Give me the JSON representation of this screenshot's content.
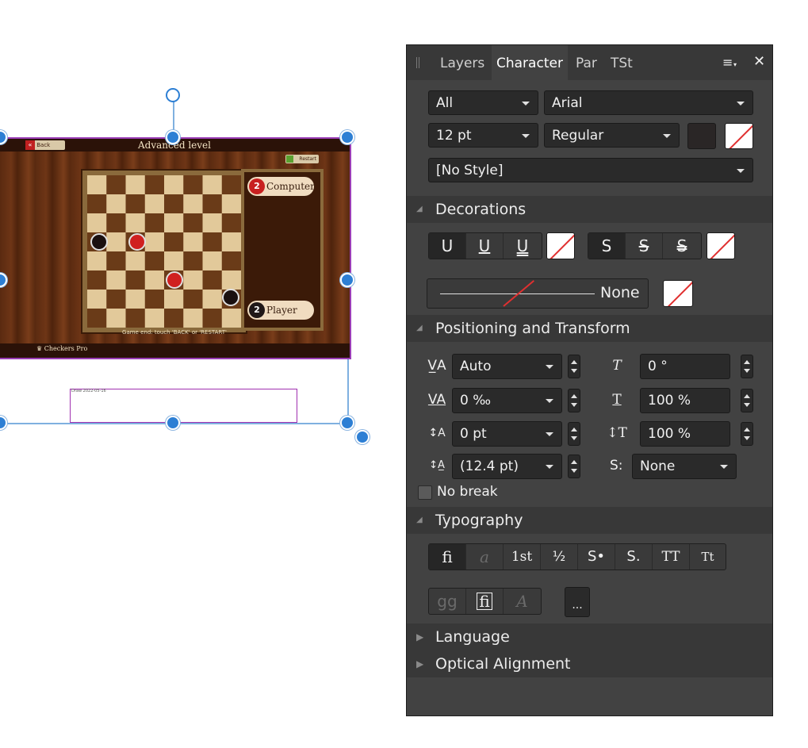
{
  "canvas": {
    "game": {
      "back_label": "Back",
      "title": "Advanced level",
      "restart_label": "Restart",
      "players": [
        {
          "num": "2",
          "name": "Computer"
        },
        {
          "num": "2",
          "name": "Player"
        }
      ],
      "footer_msg": "Game end: touch 'BACK' or 'RESTART'",
      "brand": "Checkers Pro"
    },
    "textframe_content": "Draw  2022-05-16"
  },
  "panel": {
    "tabs": [
      "Layers",
      "Character",
      "Par",
      "TSt"
    ],
    "active_tab": "Character",
    "font_collection": "All",
    "font_family": "Arial",
    "font_size": "12 pt",
    "font_style": "Regular",
    "text_style": "[No Style]",
    "sections": {
      "decorations": "Decorations",
      "positioning": "Positioning and Transform",
      "typography": "Typography",
      "language": "Language",
      "optical": "Optical Alignment"
    },
    "decorations": {
      "underline_buttons": [
        "U",
        "U",
        "U"
      ],
      "strike_buttons": [
        "S",
        "S",
        "S"
      ],
      "line_style": "None"
    },
    "positioning": {
      "kerning": "Auto",
      "shear": "0 °",
      "tracking": "0 ‰",
      "scale_h": "100 %",
      "baseline": "0 pt",
      "scale_v": "100 %",
      "leading": "(12.4 pt)",
      "smart_label": "S:",
      "smart_value": "None",
      "no_break": "No break"
    },
    "typography": {
      "buttons": [
        "fi",
        "a",
        "1st",
        "½",
        "S•",
        "S.",
        "TT",
        "Tt"
      ],
      "row2": [
        "gg",
        "fi",
        "A"
      ],
      "more": "..."
    },
    "colors": {
      "panel_bg": "#424242",
      "selection_blue": "#2d7fd4",
      "frame_purple": "#9a3db5",
      "text_fill": "#2a2626"
    }
  }
}
